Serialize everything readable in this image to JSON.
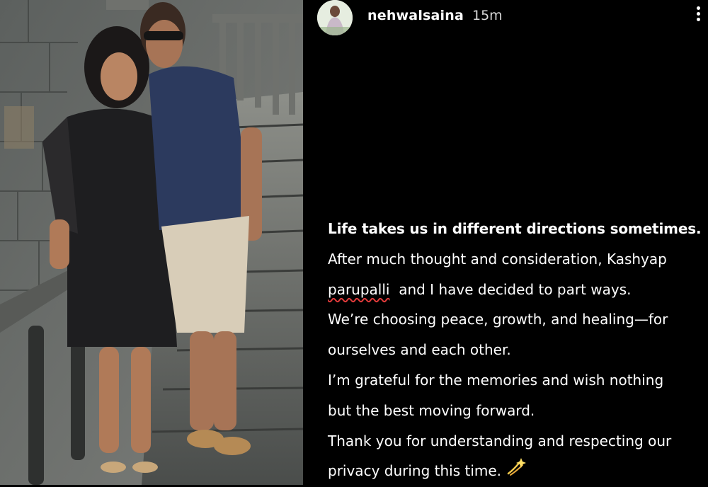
{
  "post": {
    "username": "nehwalsaina",
    "timestamp": "15m",
    "more_icon": "more-vertical-icon"
  },
  "caption": {
    "line1": "Life takes us in different directions sometimes.",
    "line2": "After much thought and consideration, Kashyap",
    "line3_mention": "parupalli",
    "line3_rest": "  and I have decided to part ways.",
    "line4": "We’re choosing peace, growth, and healing—for",
    "line5": "ourselves and each other.",
    "line6": "I’m grateful for the memories and wish nothing",
    "line7": "but the best moving forward.",
    "line8": "Thank you for understanding and respecting our",
    "line9": "privacy during this time.",
    "emoji": "sparkle-emoji"
  },
  "colors": {
    "background": "#000000",
    "text": "#ffffff",
    "mention_underline": "#e03a3a"
  }
}
